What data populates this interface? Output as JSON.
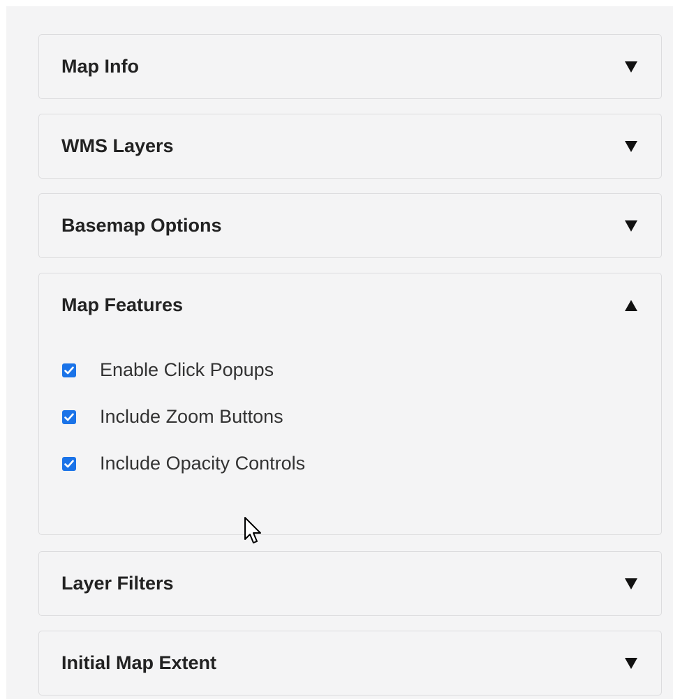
{
  "sections": [
    {
      "title": "Map Info",
      "expanded": false,
      "toggle_icon": "chevron-down-icon"
    },
    {
      "title": "WMS Layers",
      "expanded": false,
      "toggle_icon": "chevron-down-icon"
    },
    {
      "title": "Basemap Options",
      "expanded": false,
      "toggle_icon": "chevron-down-icon"
    },
    {
      "title": "Map Features",
      "expanded": true,
      "toggle_icon": "chevron-up-icon"
    },
    {
      "title": "Layer Filters",
      "expanded": false,
      "toggle_icon": "chevron-down-icon"
    },
    {
      "title": "Initial Map Extent",
      "expanded": false,
      "toggle_icon": "chevron-down-icon"
    }
  ],
  "map_features": {
    "options": [
      {
        "label": "Enable Click Popups",
        "checked": true
      },
      {
        "label": "Include Zoom Buttons",
        "checked": true
      },
      {
        "label": "Include Opacity Controls",
        "checked": true
      }
    ]
  },
  "colors": {
    "panel_bg": "#f4f4f5",
    "border": "#dcdcde",
    "checkbox_accent": "#1a73e8",
    "title_text": "#222222"
  }
}
